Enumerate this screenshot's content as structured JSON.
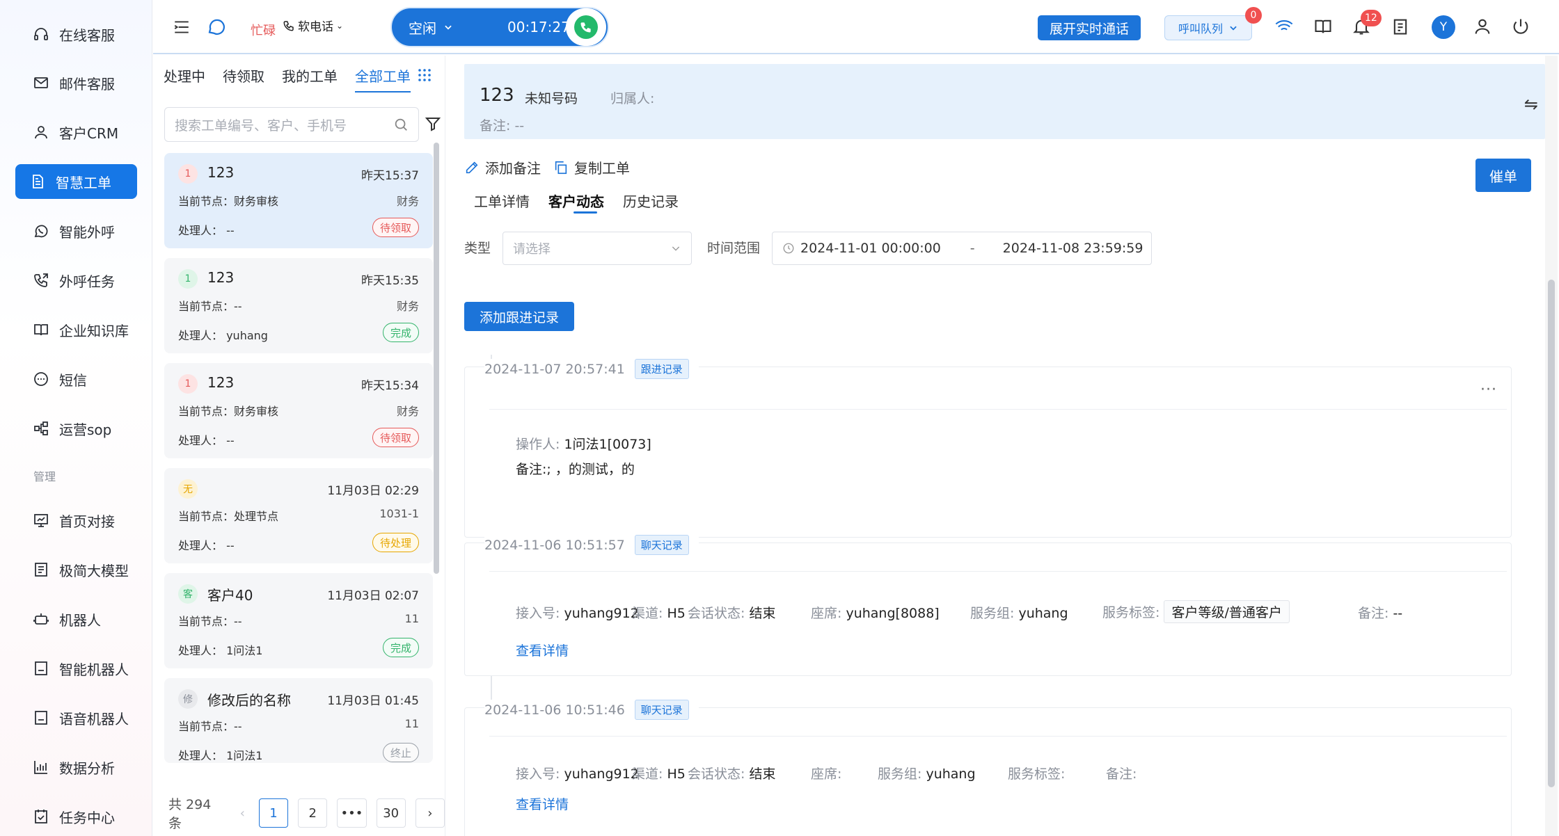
{
  "sidebar": {
    "items": [
      {
        "label": "在线客服",
        "icon": "headset-icon"
      },
      {
        "label": "邮件客服",
        "icon": "mail-icon"
      },
      {
        "label": "客户CRM",
        "icon": "user-icon"
      },
      {
        "label": "智慧工单",
        "icon": "document-icon",
        "active": true
      },
      {
        "label": "智能外呼",
        "icon": "whatsapp-icon"
      },
      {
        "label": "外呼任务",
        "icon": "phone-out-icon"
      },
      {
        "label": "企业知识库",
        "icon": "book-icon"
      },
      {
        "label": "短信",
        "icon": "sms-icon"
      },
      {
        "label": "运营sop",
        "icon": "flow-icon"
      }
    ],
    "section_label": "管理",
    "manage_items": [
      {
        "label": "首页对接",
        "icon": "monitor-icon"
      },
      {
        "label": "极简大模型",
        "icon": "model-icon"
      },
      {
        "label": "机器人",
        "icon": "robot-icon"
      },
      {
        "label": "智能机器人",
        "icon": "smart-robot-icon"
      },
      {
        "label": "语音机器人",
        "icon": "voice-robot-icon"
      },
      {
        "label": "数据分析",
        "icon": "bar-chart-icon"
      },
      {
        "label": "任务中心",
        "icon": "task-icon"
      }
    ]
  },
  "topbar": {
    "busy_label": "忙碌",
    "softphone_label": "软电话",
    "status_label": "空闲",
    "timer": "00:17:27",
    "expand_label": "展开实时通话",
    "queue_label": "呼叫队列",
    "queue_badge": "0",
    "notify_badge": "12",
    "avatar_letter": "Y"
  },
  "list": {
    "tabs": [
      "处理中",
      "待领取",
      "我的工单",
      "全部工单"
    ],
    "active_tab": 3,
    "search_placeholder": "搜索工单编号、客户、手机号",
    "cards": [
      {
        "level": "1",
        "level_color": "red",
        "title": "123",
        "time": "昨天15:37",
        "node": "当前节点：财务审核",
        "group": "财务",
        "handler": "处理人：  --",
        "status": "待领取",
        "status_type": "pending",
        "selected": true
      },
      {
        "level": "1",
        "level_color": "green",
        "title": "123",
        "time": "昨天15:35",
        "node": "当前节点：--",
        "group": "财务",
        "handler": "处理人：  yuhang",
        "status": "完成",
        "status_type": "done"
      },
      {
        "level": "1",
        "level_color": "red",
        "title": "123",
        "time": "昨天15:34",
        "node": "当前节点：财务审核",
        "group": "财务",
        "handler": "处理人：  --",
        "status": "待领取",
        "status_type": "pending"
      },
      {
        "level": "无",
        "level_color": "yellow",
        "title": "",
        "time": "11月03日 02:29",
        "node": "当前节点：处理节点",
        "group": "1031-1",
        "handler": "处理人：  --",
        "status": "待处理",
        "status_type": "todo"
      },
      {
        "level": "客",
        "level_color": "green",
        "title": "客户40",
        "time": "11月03日 02:07",
        "node": "当前节点：--",
        "group": "11",
        "handler": "处理人：  1问法1",
        "status": "完成",
        "status_type": "done"
      },
      {
        "level": "修",
        "level_color": "gray",
        "title": "修改后的名称",
        "time": "11月03日 01:45",
        "node": "当前节点：--",
        "group": "11",
        "handler": "处理人：  1问法1",
        "status": "终止",
        "status_type": "stop"
      }
    ],
    "total_label": "共 294 条",
    "pages": [
      "1",
      "2",
      "•••",
      "30"
    ]
  },
  "customer": {
    "number": "123",
    "unknown_label": "未知号码",
    "owner_label": "归属人:",
    "remark_label": "备注:  --"
  },
  "actions": {
    "add_note": "添加备注",
    "copy_ticket": "复制工单",
    "urge": "催单"
  },
  "detail_tabs": [
    "工单详情",
    "客户动态",
    "历史记录"
  ],
  "filters": {
    "type_label": "类型",
    "type_placeholder": "请选择",
    "range_label": "时间范围",
    "range_start": "2024-11-01 00:00:00",
    "range_sep": "-",
    "range_end": "2024-11-08 23:59:59"
  },
  "add_follow_label": "添加跟进记录",
  "timeline": [
    {
      "time": "2024-11-07 20:57:41",
      "tag": "跟进记录",
      "operator_label": "操作人:",
      "operator": "1问法1[0073]",
      "remark_label": "备注:",
      "remark": "; ，的测试，的"
    },
    {
      "time": "2024-11-06 10:51:57",
      "tag": "聊天记录",
      "fields": [
        {
          "label": "接入号:",
          "value": "yuhang912"
        },
        {
          "label": "渠道:",
          "value": "H5"
        },
        {
          "label": "会话状态:",
          "value": "结束"
        },
        {
          "label": "座席:",
          "value": "yuhang[8088]"
        },
        {
          "label": "服务组:",
          "value": "yuhang"
        },
        {
          "label": "服务标签:",
          "value": "客户等级/普通客户"
        },
        {
          "label": "备注:",
          "value": "--"
        }
      ],
      "link": "查看详情"
    },
    {
      "time": "2024-11-06 10:51:46",
      "tag": "聊天记录",
      "fields": [
        {
          "label": "接入号:",
          "value": "yuhang912"
        },
        {
          "label": "渠道:",
          "value": "H5"
        },
        {
          "label": "会话状态:",
          "value": "结束"
        },
        {
          "label": "座席:",
          "value": ""
        },
        {
          "label": "服务组:",
          "value": "yuhang"
        },
        {
          "label": "服务标签:",
          "value": ""
        },
        {
          "label": "备注:",
          "value": ""
        }
      ],
      "link": "查看详情"
    }
  ]
}
